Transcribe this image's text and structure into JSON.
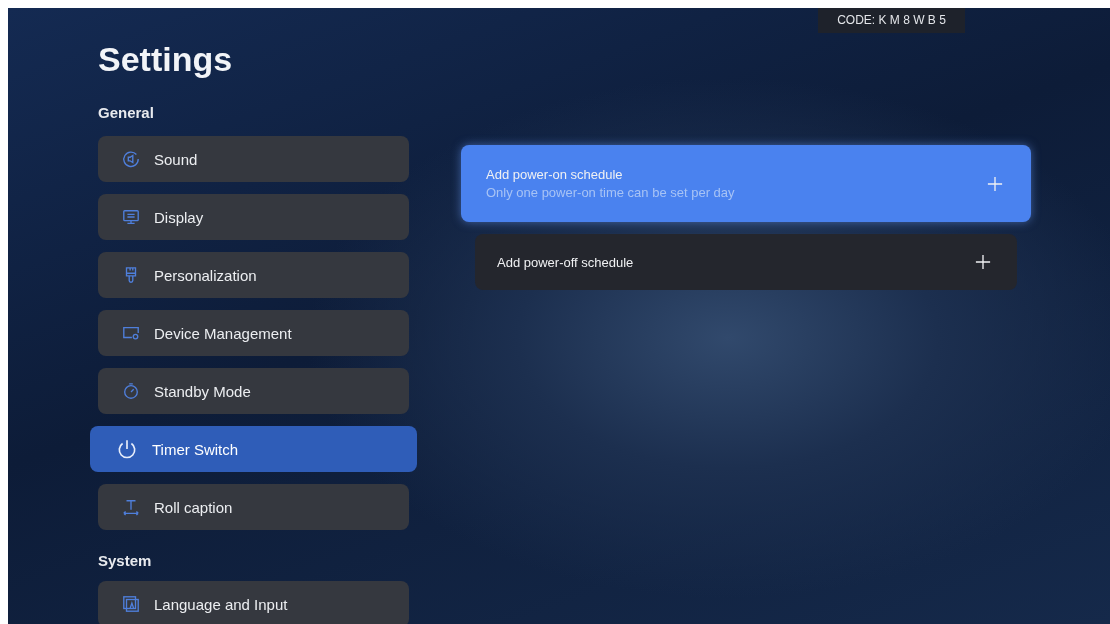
{
  "code_badge": "CODE:  K M 8 W B 5",
  "title": "Settings",
  "sections": [
    {
      "heading": "General",
      "items": [
        {
          "label": "Sound",
          "kind": "sound",
          "selected": false
        },
        {
          "label": "Display",
          "kind": "display",
          "selected": false
        },
        {
          "label": "Personalization",
          "kind": "brush",
          "selected": false
        },
        {
          "label": "Device Management",
          "kind": "device",
          "selected": false
        },
        {
          "label": "Standby Mode",
          "kind": "timer",
          "selected": false
        },
        {
          "label": "Timer Switch",
          "kind": "power",
          "selected": true
        },
        {
          "label": "Roll caption",
          "kind": "caption",
          "selected": false
        }
      ]
    },
    {
      "heading": "System",
      "items": [
        {
          "label": "Language and Input",
          "kind": "language",
          "selected": false
        }
      ]
    }
  ],
  "schedules": [
    {
      "title": "Add power-on schedule",
      "subtitle": "Only one power-on time can be set per day",
      "selected": true
    },
    {
      "title": "Add power-off schedule",
      "selected": false
    }
  ]
}
